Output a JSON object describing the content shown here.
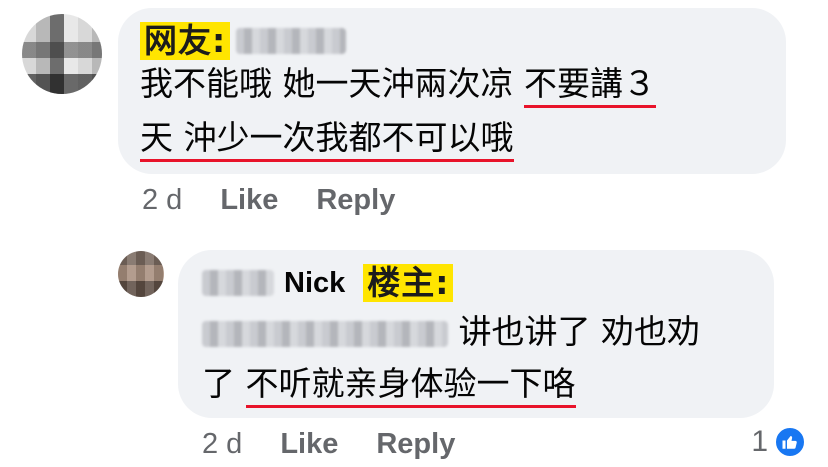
{
  "comment1": {
    "tag": "网友:",
    "lines": [
      "我不能哦 她一天沖兩次凉 ",
      "不要講３",
      "天 沖少一次我都不可以哦"
    ],
    "time": "2 d",
    "like_label": "Like",
    "reply_label": "Reply"
  },
  "comment2": {
    "author_name": "Nick",
    "tag": "楼主:",
    "line1_text": "讲也讲了 劝也劝",
    "line2_prefix": "了 ",
    "line2_underlined": "不听就亲身体验一下咯",
    "time": "2 d",
    "like_label": "Like",
    "reply_label": "Reply",
    "reaction_count": "1"
  },
  "colors": {
    "bubble": "#f0f2f5",
    "underline": "#e8132a",
    "tag_highlight": "#ffe500",
    "facebook_blue": "#1877f2"
  }
}
